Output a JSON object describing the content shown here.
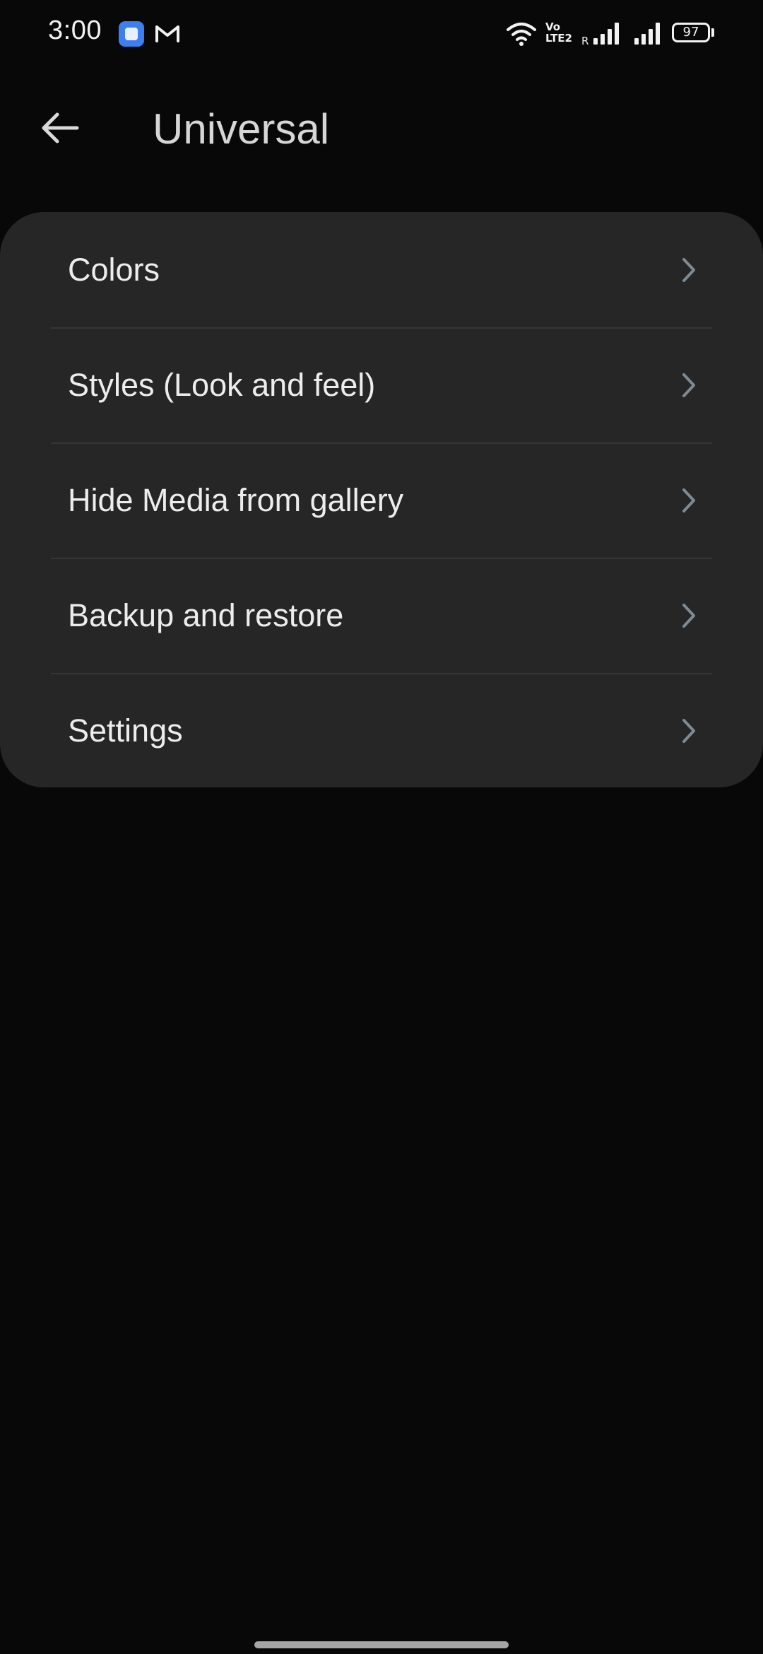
{
  "status_bar": {
    "time": "3:00",
    "volte_line1": "Vo",
    "volte_line2": "LTE2",
    "roaming": "R",
    "battery": "97",
    "icons": [
      "app-notification-icon",
      "gmail-icon",
      "wifi-icon",
      "volte-icon",
      "signal-icon",
      "battery-icon"
    ]
  },
  "app_bar": {
    "title": "Universal",
    "back_icon": "arrow-left-icon"
  },
  "menu": {
    "items": [
      {
        "label": "Colors"
      },
      {
        "label": "Styles (Look and feel)"
      },
      {
        "label": "Hide Media from gallery"
      },
      {
        "label": "Backup and restore"
      },
      {
        "label": "Settings"
      }
    ],
    "chevron_icon": "chevron-right-icon"
  },
  "colors": {
    "background": "#080808",
    "card": "#262626",
    "text": "#ededed",
    "chevron": "#7e8a94"
  }
}
